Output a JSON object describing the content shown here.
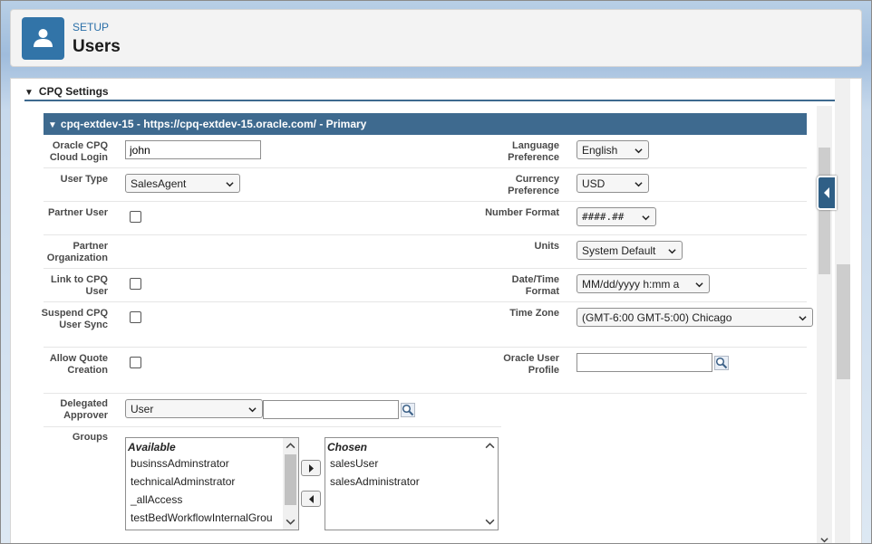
{
  "header": {
    "breadcrumb": "SETUP",
    "title": "Users",
    "icon": "user-icon"
  },
  "section": {
    "title": "CPQ Settings",
    "subsection_title": "cpq-extdev-15 - https://cpq-extdev-15.oracle.com/ - Primary"
  },
  "form": {
    "login_label": "Oracle CPQ Cloud Login",
    "login_value": "john",
    "user_type_label": "User Type",
    "user_type_value": "SalesAgent",
    "partner_user_label": "Partner User",
    "partner_org_label": "Partner Organization",
    "link_label": "Link to CPQ User",
    "suspend_label": "Suspend CPQ User Sync",
    "allow_quote_label": "Allow Quote Creation",
    "delegated_label": "Delegated Approver",
    "delegated_type_value": "User",
    "delegated_value": "",
    "groups_label": "Groups",
    "language_label": "Language Preference",
    "language_value": "English",
    "currency_label": "Currency Preference",
    "currency_value": "USD",
    "number_format_label": "Number Format",
    "number_format_value": "####.##",
    "units_label": "Units",
    "units_value": "System Default",
    "datetime_label": "Date/Time Format",
    "datetime_value": "MM/dd/yyyy h:mm a",
    "timezone_label": "Time Zone",
    "timezone_value": "(GMT-6:00 GMT-5:00) Chicago",
    "profile_label": "Oracle User Profile",
    "profile_value": ""
  },
  "groups": {
    "available_header": "Available",
    "available": [
      "businssAdminstrator",
      "technicalAdminstrator",
      "_allAccess",
      "testBedWorkflowInternalGrou"
    ],
    "chosen_header": "Chosen",
    "chosen": [
      "salesUser",
      "salesAdministrator"
    ]
  },
  "colors": {
    "header_bar": "#3e6a8f",
    "icon_bg": "#3274a8",
    "link_blue": "#2a6fa8"
  }
}
